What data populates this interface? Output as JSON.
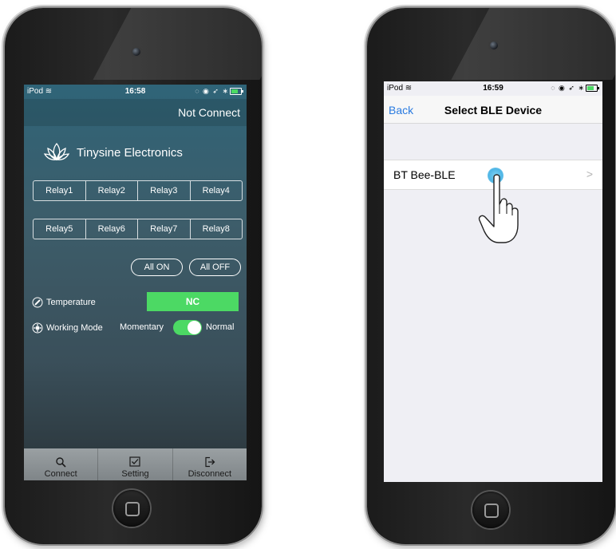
{
  "phone1": {
    "status": {
      "carrier": "iPod",
      "time": "16:58"
    },
    "nav": {
      "connection_status": "Not Connect"
    },
    "brand": {
      "name": "Tinysine Electronics"
    },
    "relays_row1": [
      "Relay1",
      "Relay2",
      "Relay3",
      "Relay4"
    ],
    "relays_row2": [
      "Relay5",
      "Relay6",
      "Relay7",
      "Relay8"
    ],
    "buttons": {
      "all_on": "All ON",
      "all_off": "All OFF"
    },
    "temperature": {
      "label": "Temperature",
      "value": "NC",
      "value_color": "#4cd964"
    },
    "working_mode": {
      "label": "Working Mode",
      "left_option": "Momentary",
      "right_option": "Normal",
      "switch_on": true
    },
    "tabs": [
      {
        "label": "Connect",
        "icon": "search-icon"
      },
      {
        "label": "Setting",
        "icon": "checkbox-icon"
      },
      {
        "label": "Disconnect",
        "icon": "logout-icon"
      }
    ]
  },
  "phone2": {
    "status": {
      "carrier": "iPod",
      "time": "16:59"
    },
    "nav": {
      "back": "Back",
      "title": "Select BLE Device"
    },
    "device_list": [
      {
        "name": "BT Bee-BLE"
      }
    ],
    "accent": "#2a7be0"
  }
}
